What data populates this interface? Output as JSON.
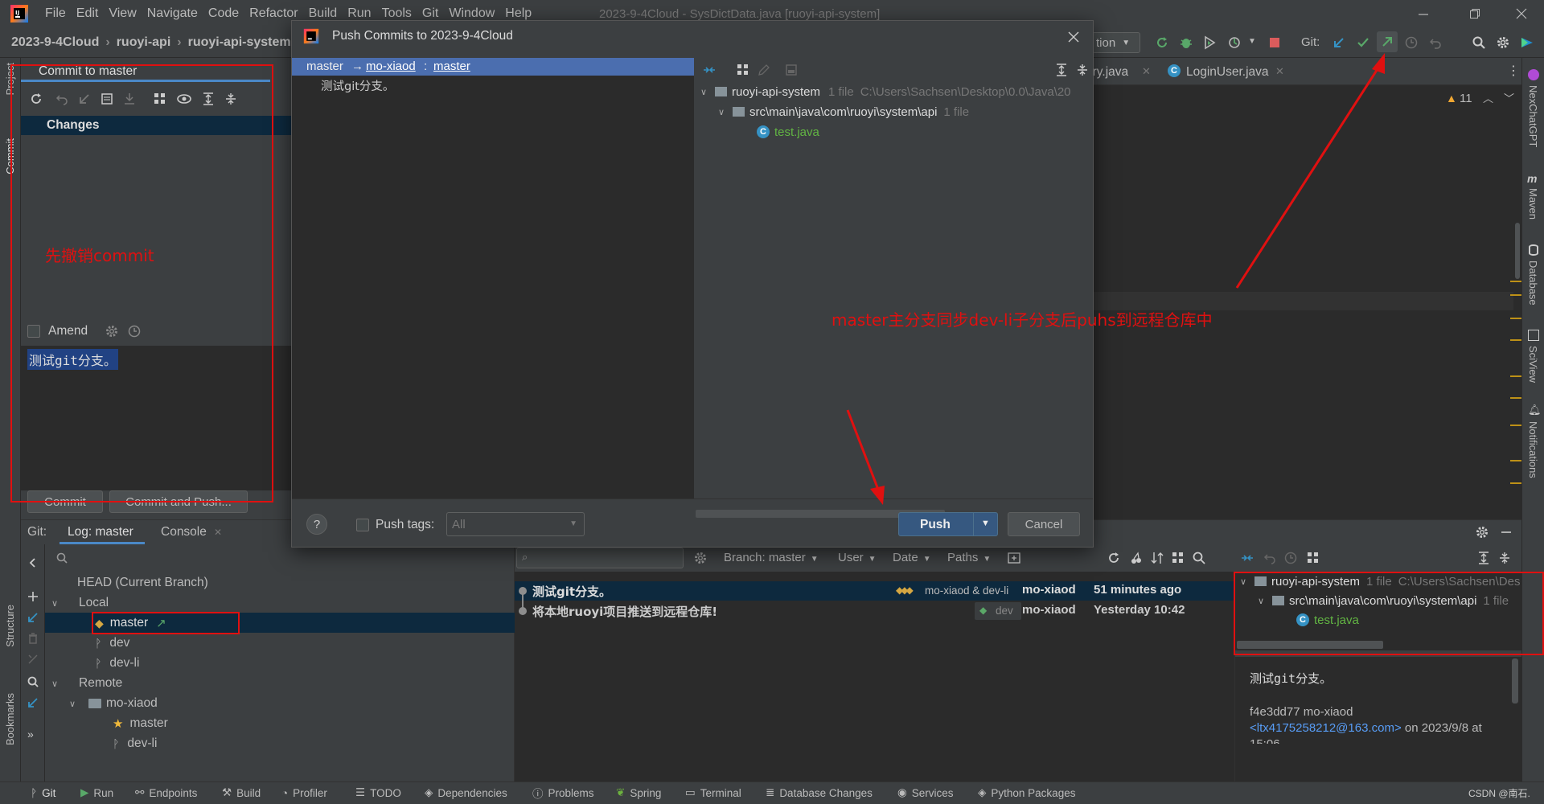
{
  "titlebar": {
    "menu": [
      "File",
      "Edit",
      "View",
      "Navigate",
      "Code",
      "Refactor",
      "Build",
      "Run",
      "Tools",
      "Git",
      "Window",
      "Help"
    ],
    "window_title": "2023-9-4Cloud - SysDictData.java [ruoyi-api-system]"
  },
  "breadcrumb": [
    "2023-9-4Cloud",
    "ruoyi-api",
    "ruoyi-api-system"
  ],
  "toolbar": {
    "run_config_partial": "tion",
    "git_label": "Git:"
  },
  "editor_tabs": [
    "ory.java",
    "LoginUser.java"
  ],
  "editor": {
    "warnings": "11"
  },
  "commit_panel": {
    "tab": "Commit to master",
    "changes_header": "Changes",
    "annotation": "先撤销commit",
    "amend_label": "Amend",
    "message": "测试git分支。",
    "commit_btn": "Commit",
    "commit_push_btn": "Commit and Push..."
  },
  "dialog": {
    "title": "Push Commits to 2023-9-4Cloud",
    "push_target": {
      "local": "master",
      "arrow": "→",
      "remote": "mo-xiaod",
      "sep": ":",
      "branch": "master"
    },
    "commit_msg": "测试git分支。",
    "files_tree": {
      "root": "ruoyi-api-system",
      "root_meta": "1 file",
      "root_path": "C:\\Users\\Sachsen\\Desktop\\0.0\\Java\\20",
      "dir": "src\\main\\java\\com\\ruoyi\\system\\api",
      "dir_meta": "1 file",
      "file": "test.java"
    },
    "help": "?",
    "push_tags_label": "Push tags:",
    "push_tags_value": "All",
    "push_btn": "Push",
    "cancel_btn": "Cancel"
  },
  "annotation_right": "master主分支同步dev-li子分支后puhs到远程仓库中",
  "left_stripe": [
    "Project",
    "Commit",
    "Structure",
    "Bookmarks"
  ],
  "right_stripe": [
    "NexChatGPT",
    "Maven",
    "Database",
    "SciView",
    "Notifications"
  ],
  "git_tool": {
    "header": "Git:",
    "tabs": [
      "Log: master",
      "Console"
    ],
    "branches": {
      "head": "HEAD (Current Branch)",
      "local": "Local",
      "local_items": [
        "master",
        "dev",
        "dev-li"
      ],
      "remote": "Remote",
      "remote_group": "mo-xiaod",
      "remote_items": [
        "master",
        "dev-li"
      ]
    },
    "filters": {
      "branch": "Branch: master",
      "user": "User",
      "date": "Date",
      "paths": "Paths"
    },
    "commits": [
      {
        "msg": "测试git分支。",
        "tags": "mo-xiaod & dev-li",
        "author": "mo-xiaod",
        "date": "51 minutes ago"
      },
      {
        "msg": "将本地ruoyi项目推送到远程仓库!",
        "tags": "dev",
        "author": "mo-xiaod",
        "date": "Yesterday 10:42"
      }
    ],
    "details_tree": {
      "root": "ruoyi-api-system",
      "root_meta": "1 file",
      "root_path": "C:\\Users\\Sachsen\\Des",
      "dir": "src\\main\\java\\com\\ruoyi\\system\\api",
      "dir_meta": "1 file",
      "file": "test.java"
    },
    "commit_details": {
      "message": "测试git分支。",
      "hash_author": "f4e3dd77 mo-xiaod",
      "email": "<ltx4175258212@163.com>",
      "date": " on 2023/9/8 at",
      "time_partial": "15:06"
    }
  },
  "bottom_bar": [
    "Git",
    "Run",
    "Endpoints",
    "Build",
    "Profiler",
    "TODO",
    "Dependencies",
    "Problems",
    "Spring",
    "Terminal",
    "Database Changes",
    "Services",
    "Python Packages"
  ],
  "watermark": "CSDN @南石.",
  "colors": {
    "accent": "#4a88c7",
    "annotation_red": "#e01010",
    "bg": "#2b2b2b",
    "panel": "#3c3f41"
  }
}
